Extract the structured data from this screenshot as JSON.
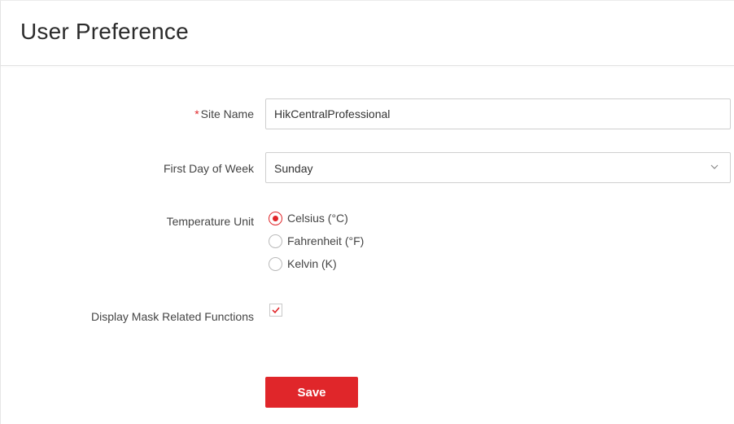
{
  "header": {
    "title": "User Preference"
  },
  "form": {
    "site_name": {
      "required_mark": "*",
      "label": "Site Name",
      "value": "HikCentralProfessional"
    },
    "first_day_of_week": {
      "label": "First Day of Week",
      "selected": "Sunday",
      "icon": "chevron-down-icon"
    },
    "temperature_unit": {
      "label": "Temperature Unit",
      "options": [
        {
          "label": "Celsius (°C)",
          "checked": true
        },
        {
          "label": "Fahrenheit (°F)",
          "checked": false
        },
        {
          "label": "Kelvin (K)",
          "checked": false
        }
      ]
    },
    "display_mask": {
      "label": "Display Mask Related Functions",
      "checked": true
    },
    "save_label": "Save"
  },
  "colors": {
    "accent": "#e0262a",
    "border": "#cfcfcf",
    "text": "#444444"
  }
}
